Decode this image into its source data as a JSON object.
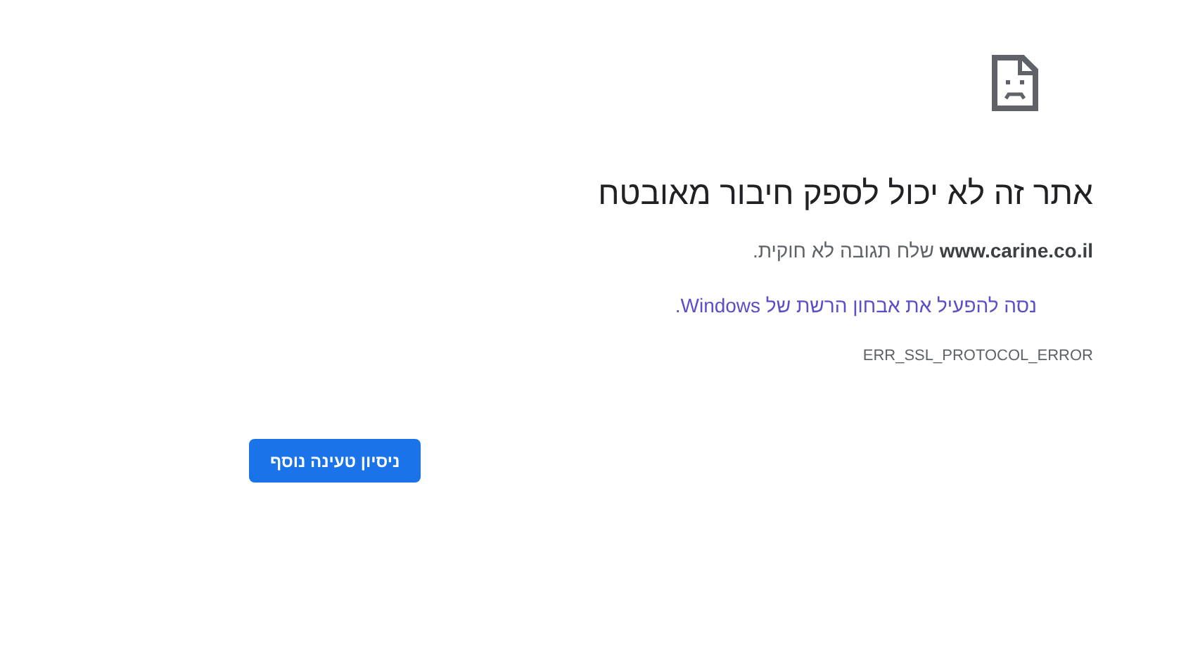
{
  "error_page": {
    "title": "אתר זה לא יכול לספק חיבור מאובטח",
    "message": "**www.carine.co.il** שלח תגובה לא חוקית.",
    "suggestion_link": "נסה להפעיל את אבחון הרשת של Windows.",
    "error_code": "ERR_SSL_PROTOCOL_ERROR",
    "reload_button": "ניסיון טעינה נוסף"
  }
}
